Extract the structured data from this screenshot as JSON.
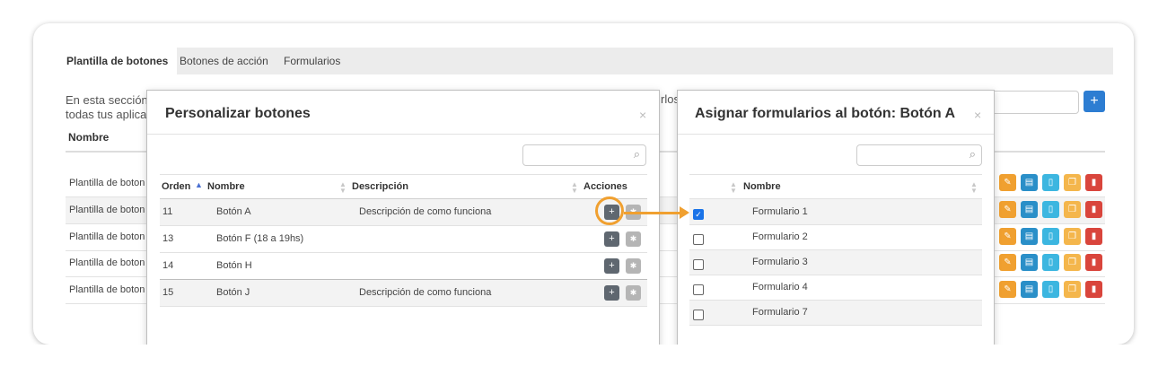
{
  "tabs": [
    "Plantilla de botones",
    "Botones de acción",
    "Formularios"
  ],
  "background": {
    "intro_line1": "En esta sección",
    "intro_line2": "todas tus aplica",
    "intro_tail": "rlos",
    "add_label": "+",
    "column_header": "Nombre",
    "rows": [
      "Plantilla de boton",
      "Plantilla de boton",
      "Plantilla de boton",
      "Plantilla de boton",
      "Plantilla de boton"
    ],
    "action_icons": [
      "edit-icon",
      "document-icon",
      "mobile-icon",
      "copy-icon",
      "delete-icon"
    ],
    "colors": {
      "edit": "#f0a030",
      "document": "#2a8fc8",
      "mobile": "#3cb6e0",
      "copy": "#f4b64c",
      "delete": "#d9453c"
    }
  },
  "modal_left": {
    "title": "Personalizar botones",
    "close": "×",
    "columns": [
      "Orden",
      "Nombre",
      "Descripción",
      "Acciones"
    ],
    "rows": [
      {
        "orden": "11",
        "nombre": "Botón A",
        "descripcion": "Descripción de como funciona"
      },
      {
        "orden": "13",
        "nombre": "Botón F (18 a 19hs)",
        "descripcion": ""
      },
      {
        "orden": "14",
        "nombre": "Botón H",
        "descripcion": ""
      },
      {
        "orden": "15",
        "nombre": "Botón J",
        "descripcion": "Descripción de como funciona"
      }
    ],
    "add_label": "+"
  },
  "modal_right": {
    "title": "Asignar formularios al botón: Botón A",
    "close": "×",
    "column": "Nombre",
    "rows": [
      {
        "nombre": "Formulario 1",
        "checked": true
      },
      {
        "nombre": "Formulario 2",
        "checked": false
      },
      {
        "nombre": "Formulario 3",
        "checked": false
      },
      {
        "nombre": "Formulario 4",
        "checked": false
      },
      {
        "nombre": "Formulario 7",
        "checked": false
      }
    ]
  },
  "accent_color": "#f0a030"
}
